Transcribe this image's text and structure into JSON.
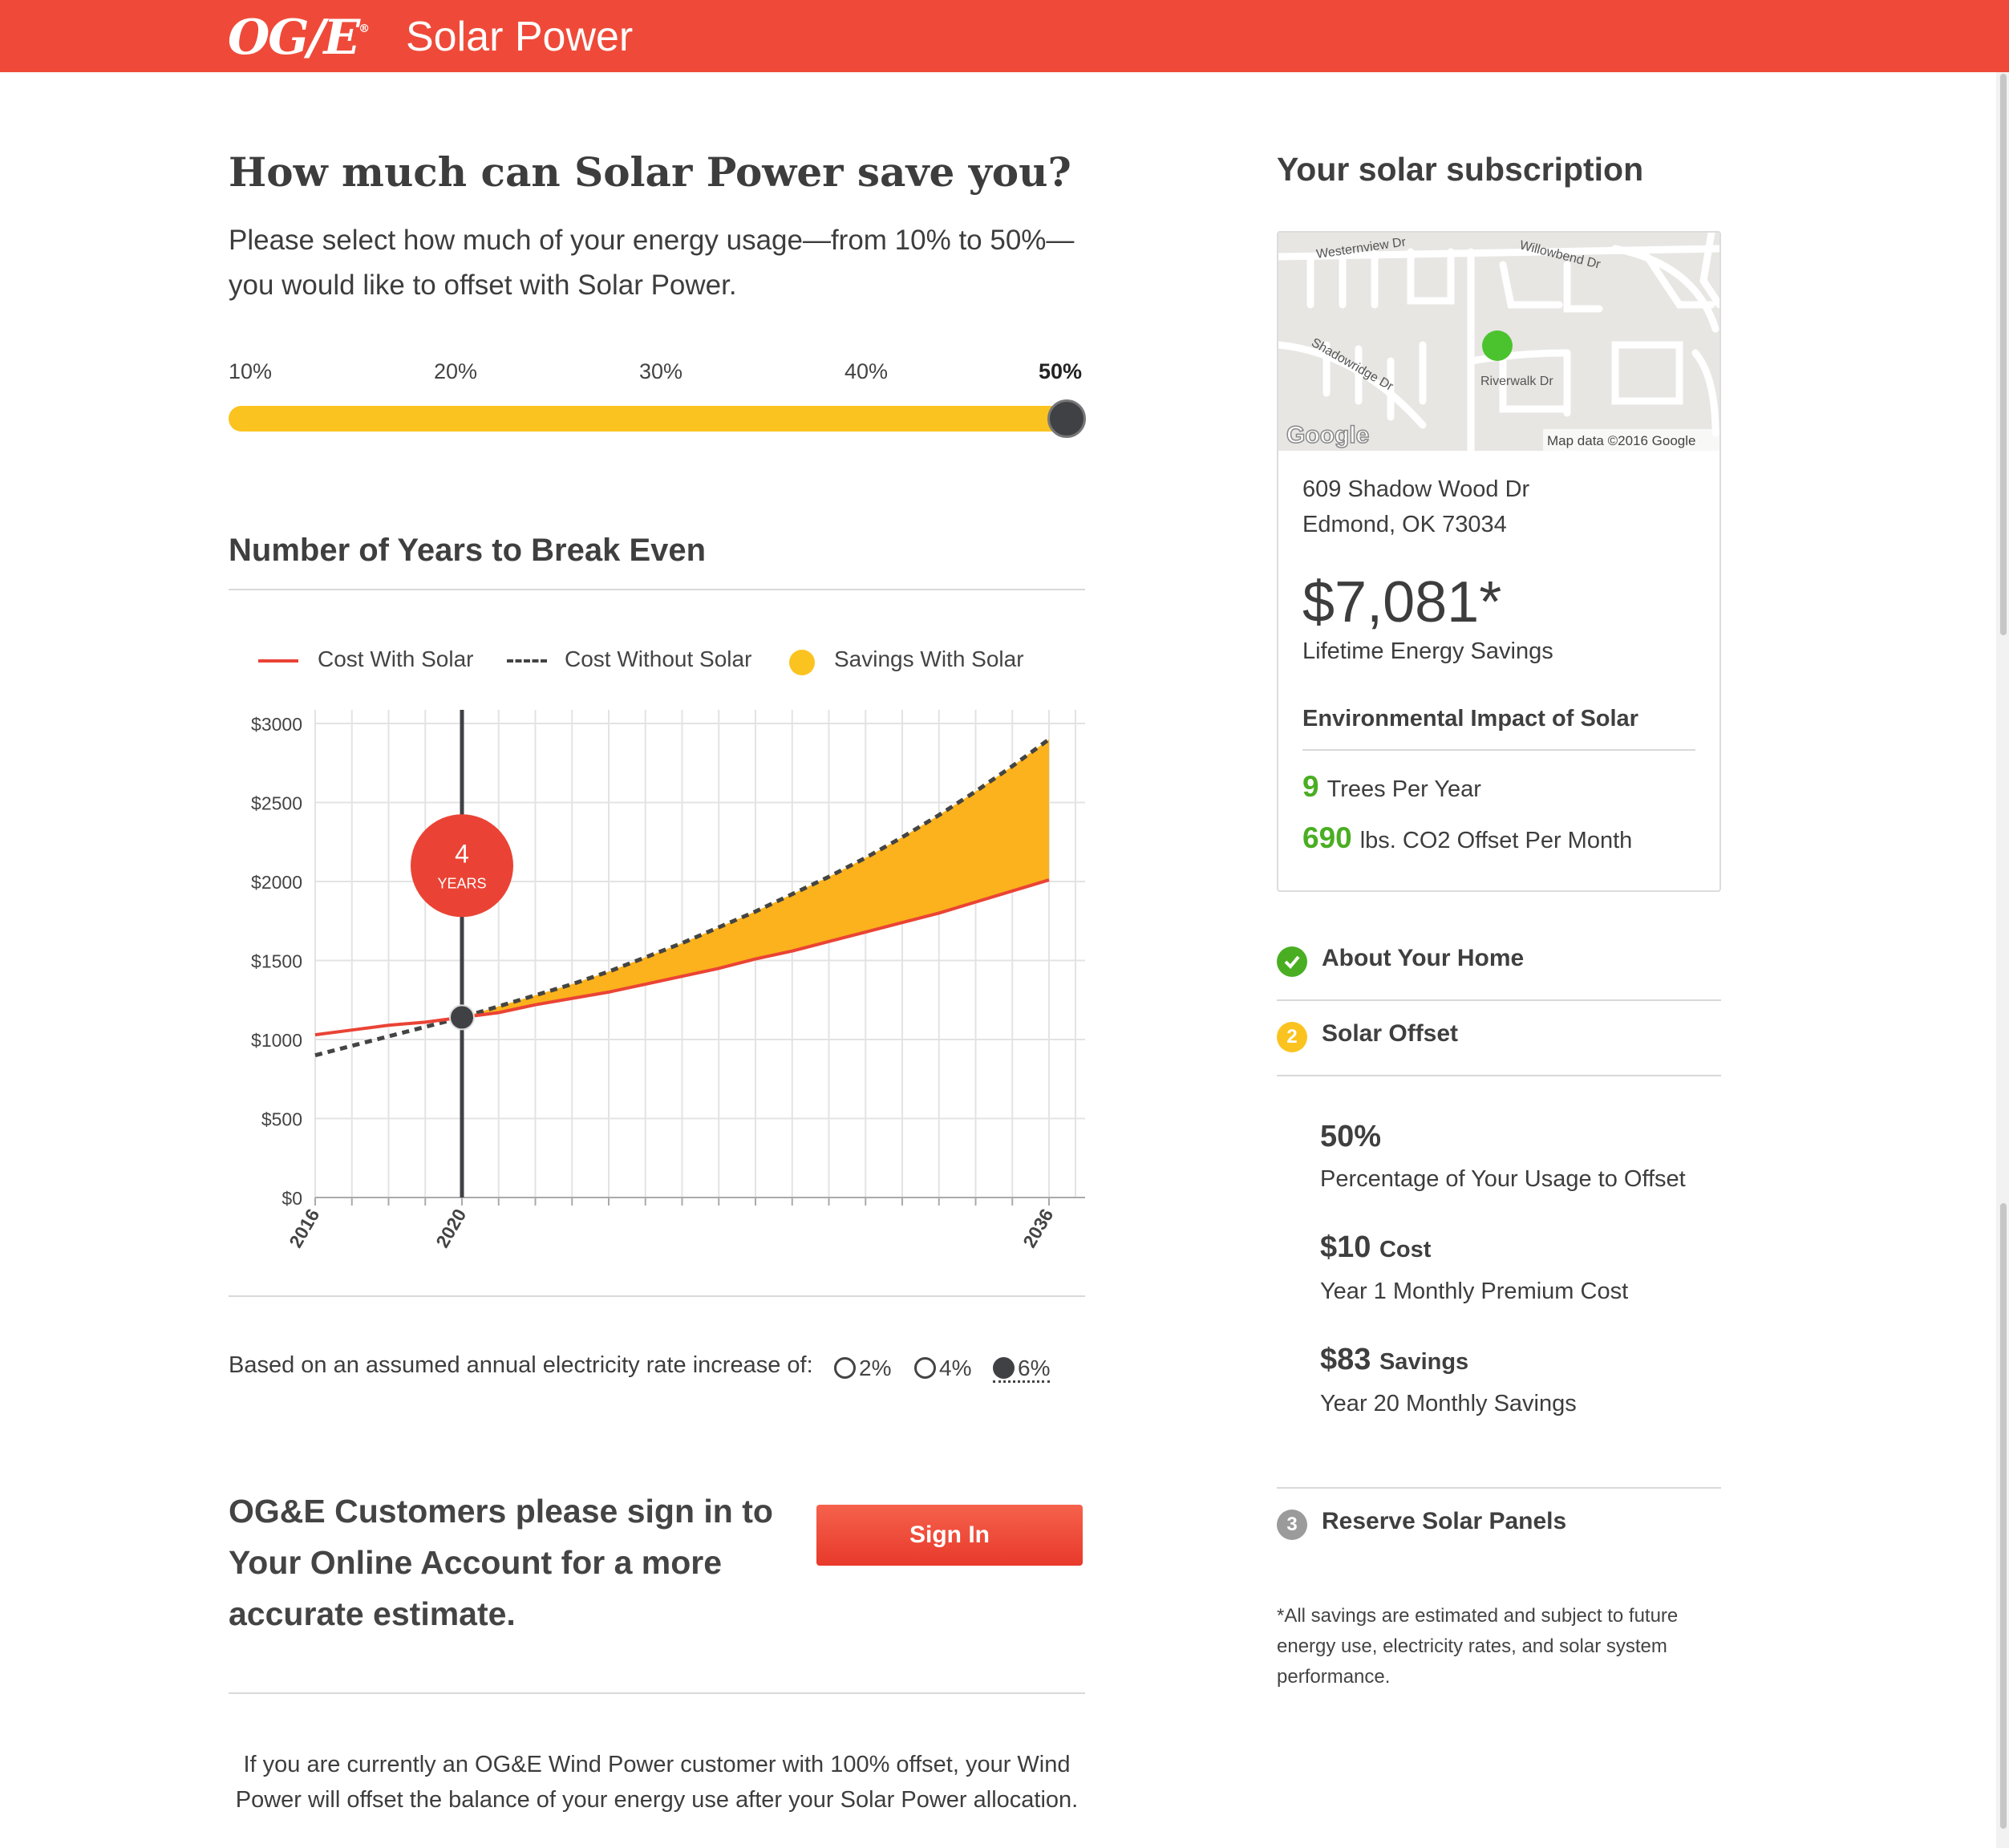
{
  "header": {
    "logo": "OG/E",
    "logo_mark": "®",
    "product": "Solar Power"
  },
  "main": {
    "heading": "How much can Solar Power save you?",
    "intro": "Please select how much of your energy usage—from 10% to 50%—you would like to offset with Solar Power.",
    "slider": {
      "labels": [
        "10%",
        "20%",
        "30%",
        "40%",
        "50%"
      ],
      "selected": "50%",
      "selected_fraction": 1.0
    },
    "chart_title": "Number of Years to Break Even",
    "legend": {
      "cost_with": "Cost With Solar",
      "cost_without": "Cost Without Solar",
      "savings": "Savings With Solar"
    },
    "rate": {
      "label": "Based on an assumed annual electricity rate increase of:",
      "options": [
        "2%",
        "4%",
        "6%"
      ],
      "selected": "6%"
    },
    "cta": "OG&E Customers please sign in to Your Online Account for a more accurate estimate.",
    "signin_label": "Sign In",
    "note": "If you are currently an OG&E Wind Power customer with 100% offset, your Wind Power will offset the balance of your energy use after your Solar Power allocation."
  },
  "chart_data": {
    "type": "line",
    "title": "",
    "xlabel": "",
    "ylabel": "",
    "ylim": [
      0,
      3000
    ],
    "xlim": [
      2016,
      2036
    ],
    "y_ticks": [
      "$3000",
      "$2500",
      "$2000",
      "$1500",
      "$1000",
      "$500",
      "$0"
    ],
    "x_tick_labels": [
      "2016",
      "2020",
      "2036"
    ],
    "x": [
      2016,
      2017,
      2018,
      2019,
      2020,
      2021,
      2022,
      2023,
      2024,
      2025,
      2026,
      2027,
      2028,
      2029,
      2030,
      2031,
      2032,
      2033,
      2034,
      2035,
      2036
    ],
    "series": [
      {
        "name": "Cost With Solar",
        "values": [
          1030,
          1060,
          1090,
          1110,
          1140,
          1170,
          1220,
          1260,
          1300,
          1350,
          1400,
          1450,
          1510,
          1560,
          1620,
          1680,
          1740,
          1800,
          1870,
          1940,
          2010
        ]
      },
      {
        "name": "Cost Without Solar",
        "values": [
          900,
          960,
          1020,
          1080,
          1140,
          1210,
          1280,
          1350,
          1430,
          1520,
          1610,
          1710,
          1810,
          1920,
          2030,
          2150,
          2280,
          2420,
          2570,
          2730,
          2900
        ]
      }
    ],
    "break_even": {
      "year": 2020,
      "value": 1140,
      "count": "4",
      "unit": "YEARS"
    },
    "colors": {
      "with": "#ea4335",
      "without": "#444444",
      "savings": "#fbb21c",
      "marker": "#ea4335"
    }
  },
  "sidebar": {
    "title": "Your solar subscription",
    "map": {
      "streets": [
        "Westernview Dr",
        "Willowbend Dr",
        "Shadowridge Dr",
        "Riverwalk Dr"
      ],
      "logo": "Google",
      "attribution": "Map data ©2016 Google"
    },
    "address_line1": "609 Shadow Wood Dr",
    "address_line2": "Edmond, OK 73034",
    "savings": "$7,081*",
    "savings_label": "Lifetime Energy Savings",
    "env_title": "Environmental Impact of Solar",
    "trees_value": "9",
    "trees_label": "Trees Per Year",
    "co2_value": "690",
    "co2_label": "lbs. CO2 Offset Per Month",
    "steps": [
      {
        "num": "✓",
        "label": "About Your Home"
      },
      {
        "num": "2",
        "label": "Solar Offset"
      },
      {
        "num": "3",
        "label": "Reserve Solar Panels"
      }
    ],
    "offset_value": "50%",
    "offset_label": "Percentage of Your Usage to Offset",
    "cost_value": "$10",
    "cost_unit": "Cost",
    "cost_label": "Year 1 Monthly Premium Cost",
    "save_value": "$83",
    "save_unit": "Savings",
    "save_label": "Year 20 Monthly Savings",
    "disclaimer": "*All savings are estimated and subject to future energy use, electricity rates, and solar system performance.",
    "status_colors": {
      "done": "#4aae22",
      "current": "#fbc31f",
      "pending": "#9b9b9b"
    }
  }
}
